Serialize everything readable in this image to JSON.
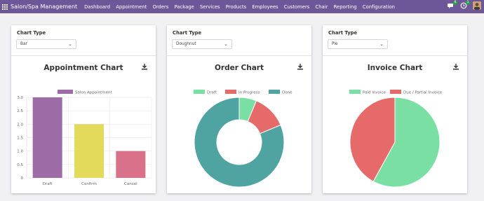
{
  "navbar": {
    "brand": "Salon/Spa Management",
    "menu": [
      "Dashboard",
      "Appointment",
      "Orders",
      "Package",
      "Services",
      "Products",
      "Employees",
      "Customers",
      "Chair",
      "Reporting",
      "Configuration"
    ],
    "messages_count": "6",
    "activities_count": "1",
    "bg_color": "#6e5798"
  },
  "cards": [
    {
      "chart_type_label": "Chart Type",
      "chart_type_value": "Bar",
      "title": "Appointment Chart"
    },
    {
      "chart_type_label": "Chart Type",
      "chart_type_value": "Doughnut",
      "title": "Order Chart"
    },
    {
      "chart_type_label": "Chart Type",
      "chart_type_value": "Pie",
      "title": "Invoice Chart"
    }
  ],
  "chart_data": [
    {
      "type": "bar",
      "title": "Appointment Chart",
      "categories": [
        "Draft",
        "Confirm",
        "Cancel"
      ],
      "series": [
        {
          "name": "Salon Appointment",
          "values": [
            3,
            2,
            1
          ]
        }
      ],
      "colors": [
        "#9d6ba6",
        "#e3d95b",
        "#d87189"
      ],
      "ylim": [
        0,
        3
      ],
      "yticks": [
        "0",
        "0.5",
        "1.0",
        "1.5",
        "2.0",
        "2.5",
        "3.0"
      ],
      "legend": "top",
      "grid": true
    },
    {
      "type": "doughnut",
      "title": "Order Chart",
      "labels": [
        "Draft",
        "In Progress",
        "Done"
      ],
      "values": [
        1,
        2,
        13
      ],
      "colors": [
        "#7adfa3",
        "#e56a69",
        "#4fa3a1"
      ],
      "legend": "top"
    },
    {
      "type": "pie",
      "title": "Invoice Chart",
      "labels": [
        "Paid Invoice",
        "Due / Partial Invoice"
      ],
      "values": [
        58,
        42
      ],
      "colors": [
        "#7adfa3",
        "#e56a69"
      ],
      "legend": "top"
    }
  ]
}
